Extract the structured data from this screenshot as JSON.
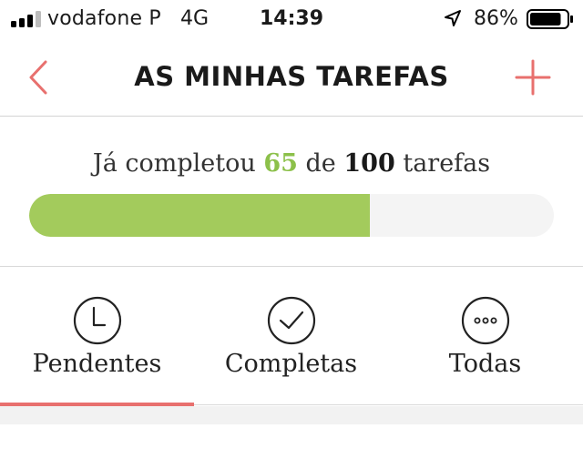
{
  "status_bar": {
    "carrier": "vodafone P",
    "network": "4G",
    "time": "14:39",
    "battery_percent": "86%",
    "battery_level": 0.86,
    "icons": [
      "signal-icon",
      "location-arrow-icon",
      "battery-icon"
    ]
  },
  "nav": {
    "title": "AS MINHAS TAREFAS",
    "back_icon": "chevron-left-icon",
    "add_icon": "plus-icon",
    "accent_color": "#e8706e"
  },
  "progress": {
    "prefix": "Já completou",
    "completed": "65",
    "middle": "de",
    "total": "100",
    "suffix": "tarefas",
    "fraction": 0.65,
    "fill_color": "#a3cb5c"
  },
  "tabs": [
    {
      "label": "Pendentes",
      "icon": "clock-icon",
      "active": true
    },
    {
      "label": "Completas",
      "icon": "checkmark-icon",
      "active": false
    },
    {
      "label": "Todas",
      "icon": "ellipsis-icon",
      "active": false
    }
  ]
}
